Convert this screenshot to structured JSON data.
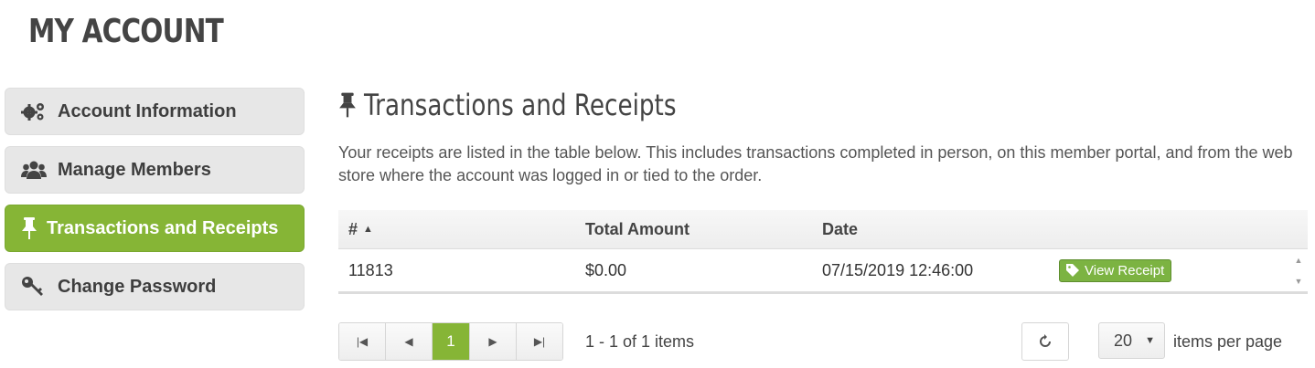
{
  "page": {
    "title": "MY ACCOUNT"
  },
  "sidebar": {
    "items": [
      {
        "label": "Account Information",
        "icon": "gears-icon",
        "active": false
      },
      {
        "label": "Manage Members",
        "icon": "users-icon",
        "active": false
      },
      {
        "label": "Transactions and Receipts",
        "icon": "pushpin-icon",
        "active": true
      },
      {
        "label": "Change Password",
        "icon": "key-icon",
        "active": false
      }
    ]
  },
  "main": {
    "heading": "Transactions and Receipts",
    "heading_icon": "pushpin-icon",
    "intro": "Your receipts are listed in the table below. This includes transactions completed in person, on this member portal, and from the web store where the account was logged in or tied to the order.",
    "table": {
      "columns": [
        "#",
        "Total Amount",
        "Date",
        ""
      ],
      "rows": [
        {
          "number": "11813",
          "amount": "$0.00",
          "date": "07/15/2019 12:46:00",
          "action": "View Receipt"
        }
      ]
    },
    "pager": {
      "current_page": "1",
      "info": "1 - 1 of 1 items",
      "page_size": "20",
      "per_page_label": "items per page"
    }
  },
  "colors": {
    "accent": "#86b536",
    "text": "#444444"
  }
}
